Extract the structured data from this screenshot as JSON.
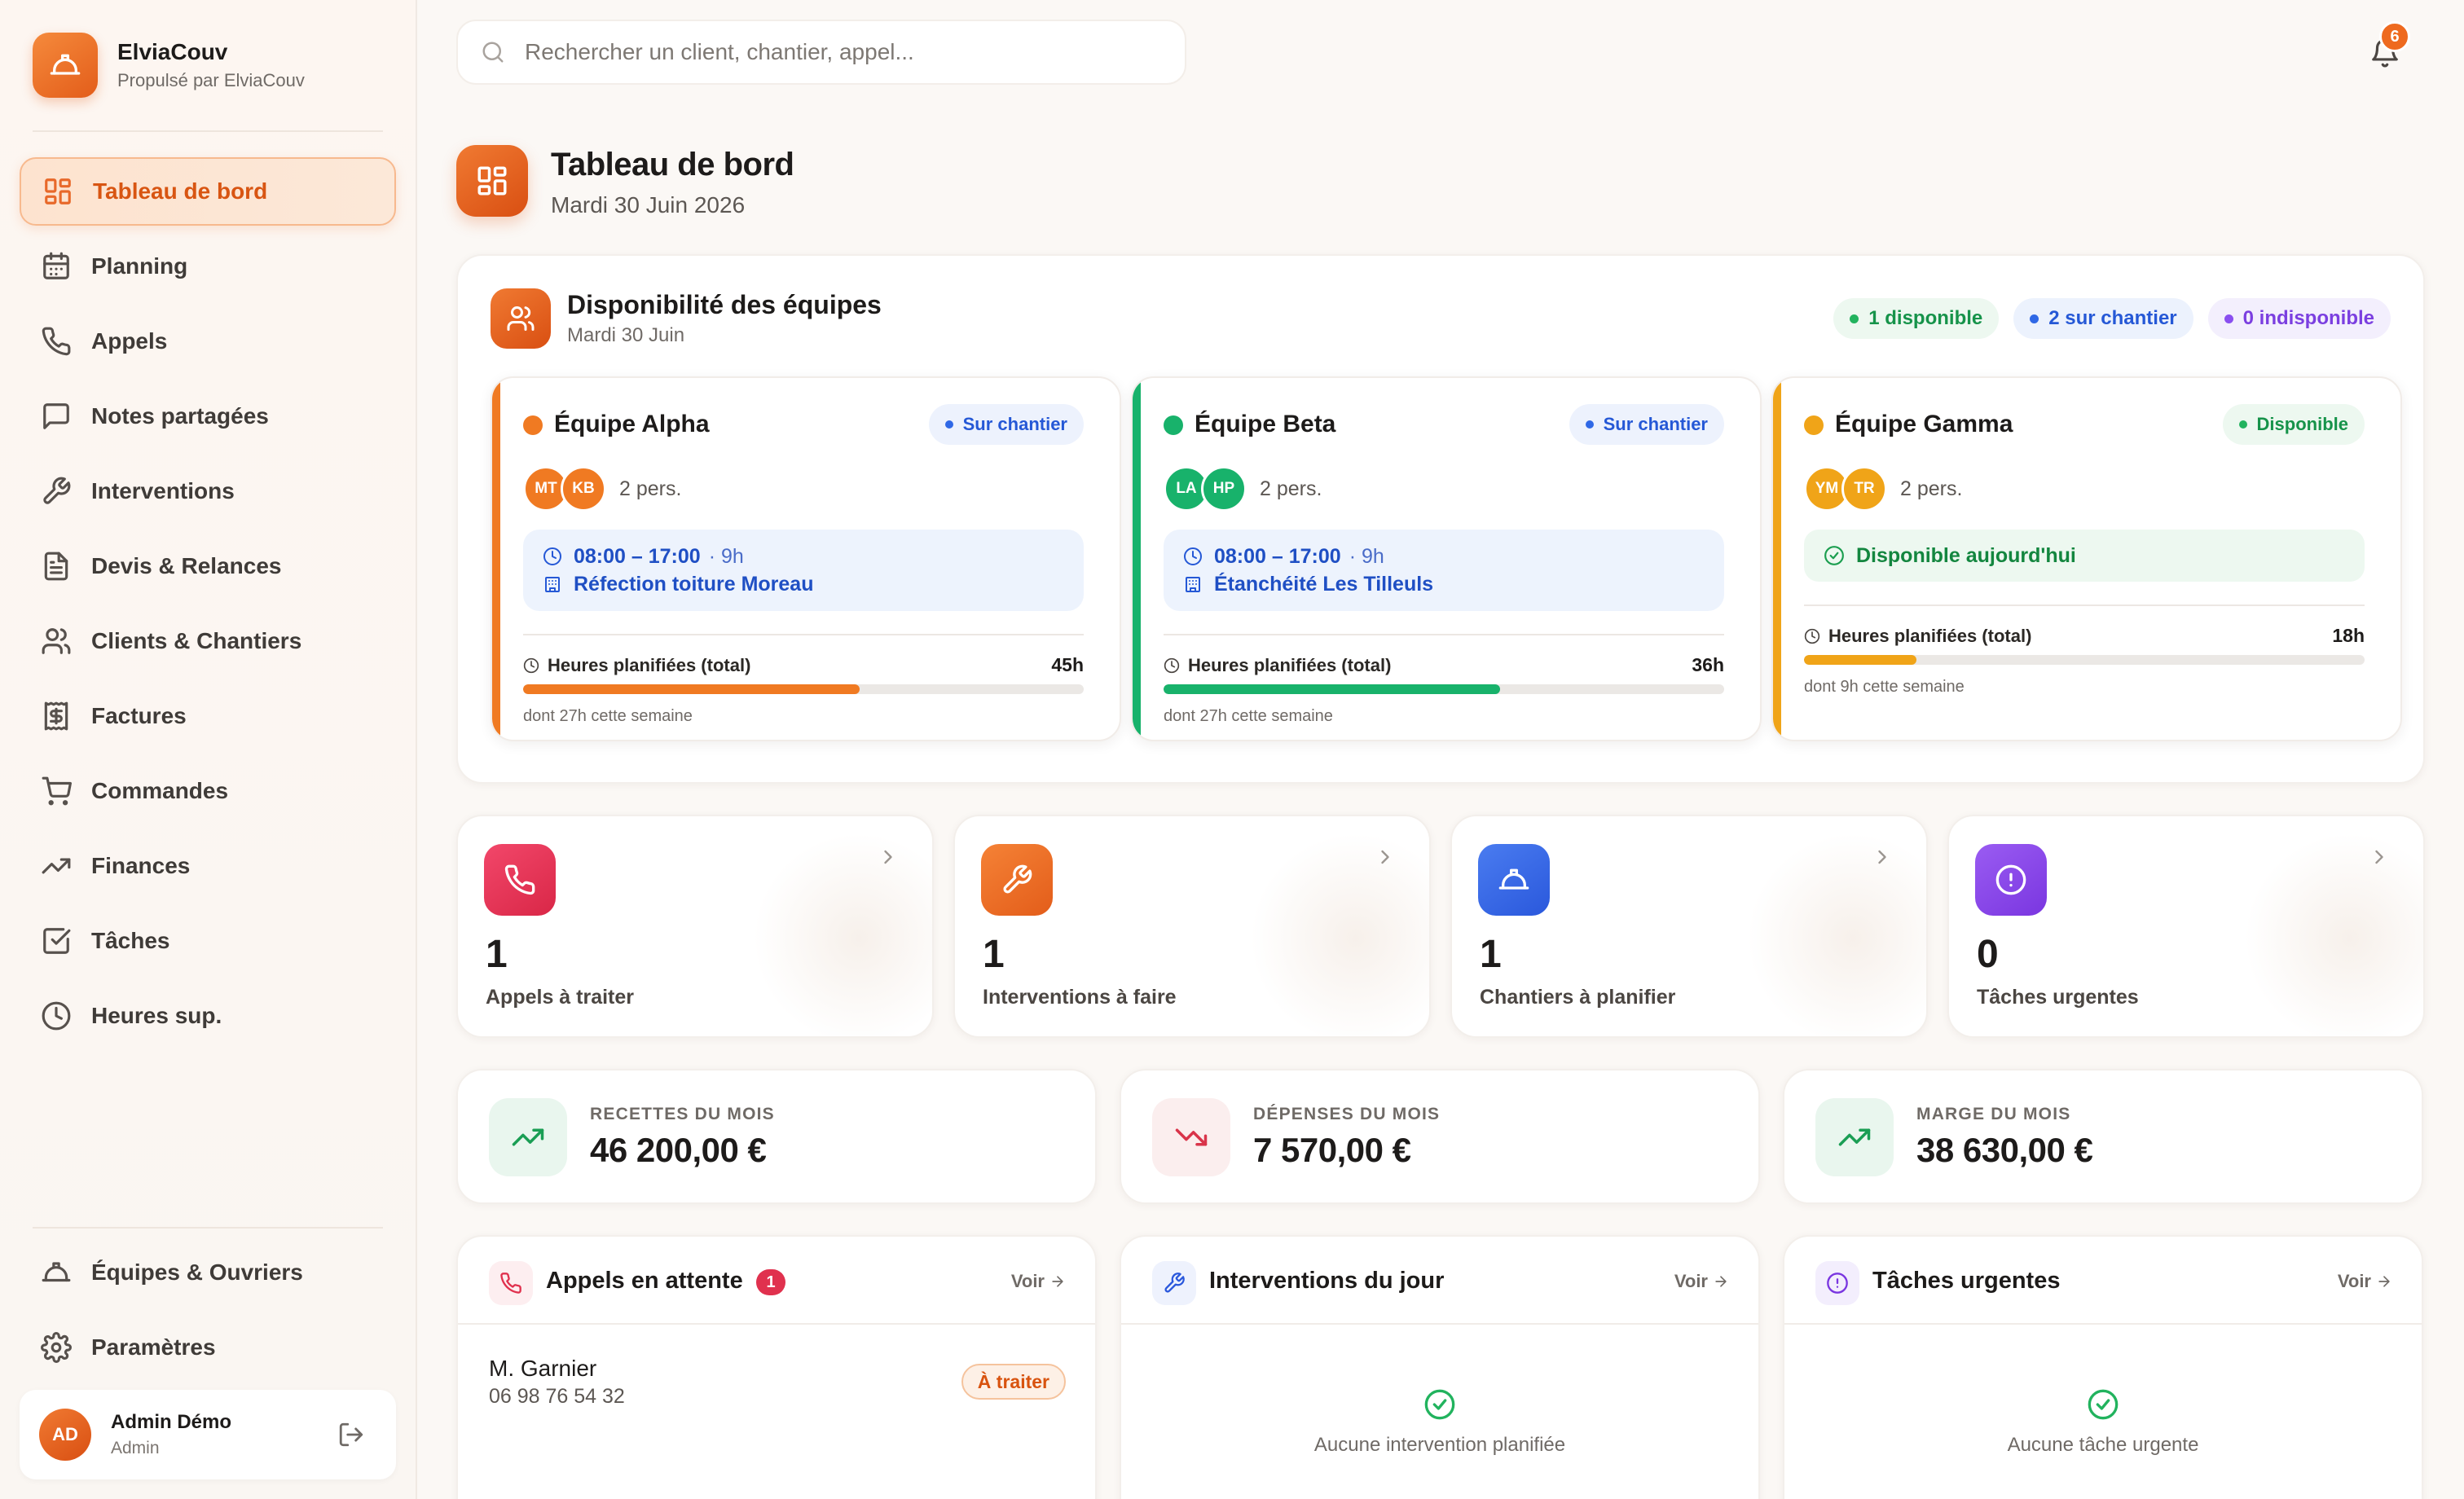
{
  "brand": {
    "name": "ElviaCouv",
    "subtitle": "Propulsé par ElviaCouv"
  },
  "nav": {
    "items": [
      {
        "label": "Tableau de bord",
        "icon": "dashboard-icon",
        "active": true
      },
      {
        "label": "Planning",
        "icon": "calendar-icon"
      },
      {
        "label": "Appels",
        "icon": "phone-icon"
      },
      {
        "label": "Notes partagées",
        "icon": "message-icon"
      },
      {
        "label": "Interventions",
        "icon": "wrench-icon"
      },
      {
        "label": "Devis & Relances",
        "icon": "document-icon"
      },
      {
        "label": "Clients & Chantiers",
        "icon": "users-icon"
      },
      {
        "label": "Factures",
        "icon": "invoice-icon"
      },
      {
        "label": "Commandes",
        "icon": "cart-icon"
      },
      {
        "label": "Finances",
        "icon": "trending-icon"
      },
      {
        "label": "Tâches",
        "icon": "checkbox-icon"
      },
      {
        "label": "Heures sup.",
        "icon": "clock-icon"
      }
    ],
    "bottom": [
      {
        "label": "Équipes & Ouvriers",
        "icon": "hardhat-icon"
      },
      {
        "label": "Paramètres",
        "icon": "settings-icon"
      }
    ]
  },
  "user": {
    "initials": "AD",
    "name": "Admin Démo",
    "role": "Admin"
  },
  "search": {
    "placeholder": "Rechercher un client, chantier, appel..."
  },
  "notifications": {
    "count": "6"
  },
  "header": {
    "title": "Tableau de bord",
    "date": "Mardi 30 Juin 2026"
  },
  "availability": {
    "title": "Disponibilité des équipes",
    "date": "Mardi 30 Juin",
    "pills": {
      "available": "1 disponible",
      "onsite": "2 sur chantier",
      "unavailable": "0 indisponible"
    },
    "teams": [
      {
        "name": "Équipe Alpha",
        "status": "Sur chantier",
        "color": "#f07a22",
        "members": [
          "MT",
          "KB"
        ],
        "people": "2 pers.",
        "time": "08:00 – 17:00",
        "duration": "· 9h",
        "site": "Réfection toiture Moreau",
        "hours_label": "Heures planifiées (total)",
        "hours": "45h",
        "progress": 0.6,
        "week": "dont 27h cette semaine"
      },
      {
        "name": "Équipe Beta",
        "status": "Sur chantier",
        "color": "#18b26b",
        "members": [
          "LA",
          "HP"
        ],
        "people": "2 pers.",
        "time": "08:00 – 17:00",
        "duration": "· 9h",
        "site": "Étanchéité Les Tilleuls",
        "hours_label": "Heures planifiées (total)",
        "hours": "36h",
        "progress": 0.6,
        "week": "dont 27h cette semaine"
      },
      {
        "name": "Équipe Gamma",
        "status": "Disponible",
        "color": "#f0a418",
        "members": [
          "YM",
          "TR"
        ],
        "people": "2 pers.",
        "free": "Disponible aujourd'hui",
        "hours_label": "Heures planifiées (total)",
        "hours": "18h",
        "progress": 0.2,
        "week": "dont 9h cette semaine"
      }
    ]
  },
  "stats": [
    {
      "value": "1",
      "label": "Appels à traiter",
      "icon": "phone-icon",
      "color": "#e8344e"
    },
    {
      "value": "1",
      "label": "Interventions à faire",
      "icon": "wrench-icon",
      "color": "#ee6a1f"
    },
    {
      "value": "1",
      "label": "Chantiers à planifier",
      "icon": "hardhat-icon",
      "color": "#3165e8"
    },
    {
      "value": "0",
      "label": "Tâches urgentes",
      "icon": "alert-icon",
      "color": "#8b45e8"
    }
  ],
  "finance": [
    {
      "label": "RECETTES DU MOIS",
      "value": "46 200,00 €",
      "icon": "trending-up-icon"
    },
    {
      "label": "DÉPENSES DU MOIS",
      "value": "7 570,00 €",
      "icon": "trending-down-icon"
    },
    {
      "label": "MARGE DU MOIS",
      "value": "38 630,00 €",
      "icon": "trending-up-icon"
    }
  ],
  "lists": {
    "calls": {
      "title": "Appels en attente",
      "count": "1",
      "link": "Voir",
      "rows": [
        {
          "name": "M. Garnier",
          "phone": "06 98 76 54 32",
          "status": "À traiter"
        }
      ]
    },
    "interventions": {
      "title": "Interventions du jour",
      "link": "Voir",
      "empty": "Aucune intervention planifiée"
    },
    "tasks": {
      "title": "Tâches urgentes",
      "link": "Voir",
      "empty": "Aucune tâche urgente"
    }
  }
}
